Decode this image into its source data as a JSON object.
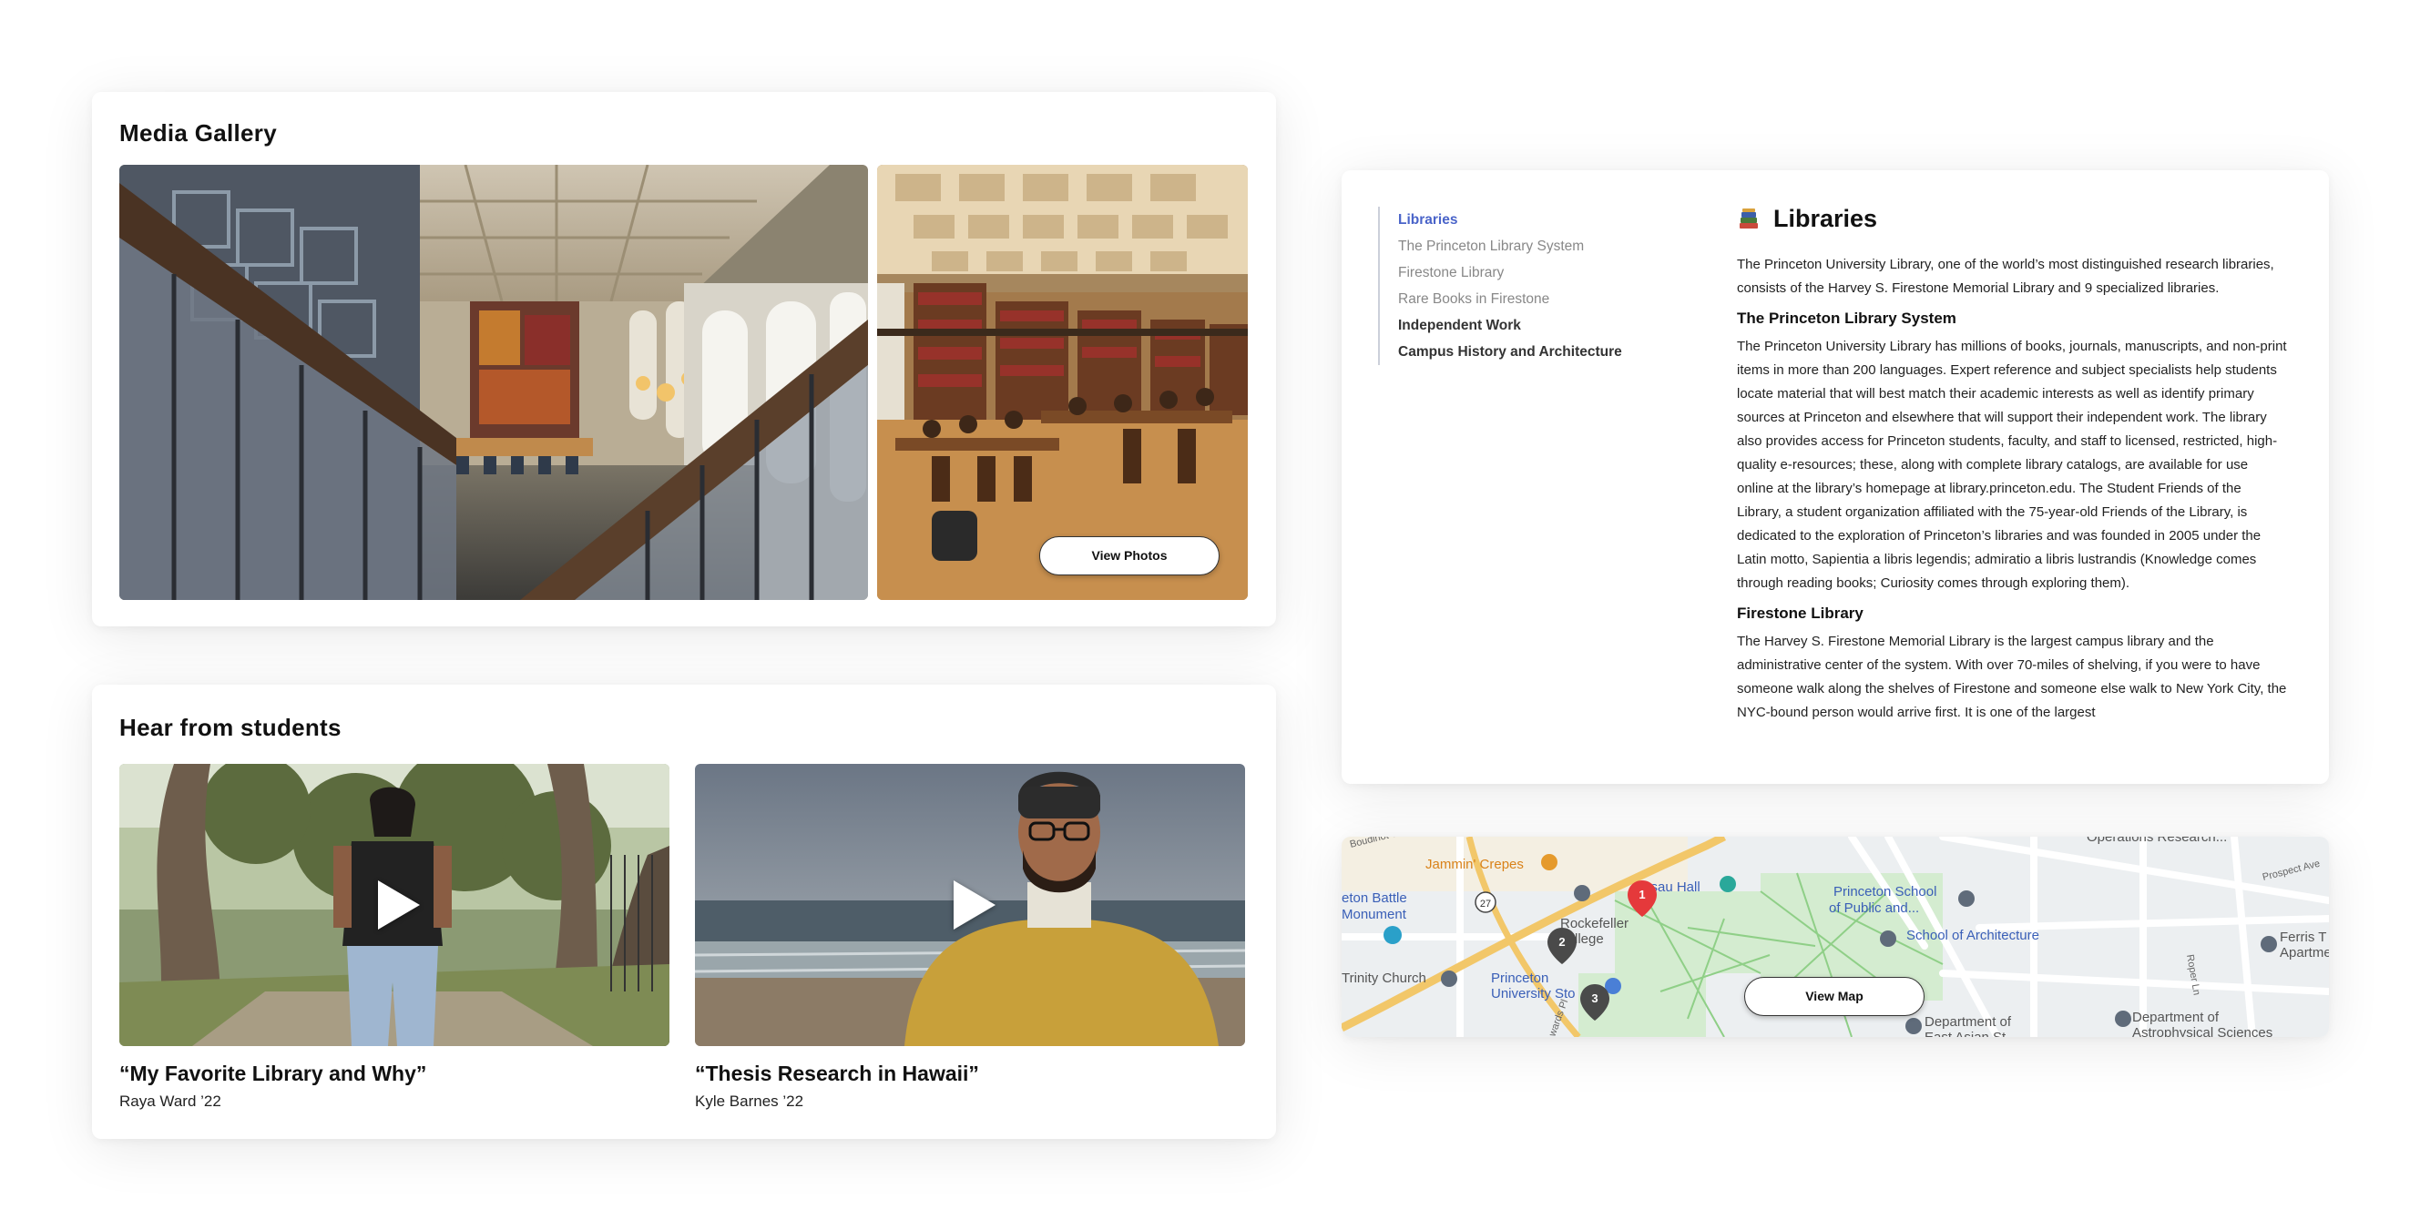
{
  "gallery": {
    "title": "Media Gallery",
    "view_photos_label": "View Photos"
  },
  "students": {
    "title": "Hear from students",
    "videos": [
      {
        "title": "“My Favorite Library and Why”",
        "author": "Raya Ward ’22"
      },
      {
        "title": "“Thesis Research in Hawaii”",
        "author": "Kyle Barnes ’22"
      }
    ]
  },
  "libraries": {
    "toc": [
      "Libraries",
      "The Princeton Library System",
      "Firestone Library",
      "Rare Books in Firestone",
      "Independent Work",
      "Campus History and Architecture"
    ],
    "title": "Libraries",
    "intro": "The Princeton University Library, one of the world’s most distinguished research libraries, consists of the Harvey S. Firestone Memorial Library and 9 specialized libraries.",
    "section1_title": "The Princeton Library System",
    "section1_text": "The Princeton University Library has millions of books, journals, manuscripts, and non-print items in more than 200 languages. Expert reference and subject specialists help students locate material that will best match their academic interests as well as identify primary sources at Princeton and elsewhere that will support their independent work. The library also provides access for Princeton students, faculty, and staff to licensed, restricted, high-quality e-resources; these, along with complete library catalogs, are available for use online at the library’s homepage at library.princeton.edu. The Student Friends of the Library, a student organization affiliated with the 75-year-old Friends of the Library, is dedicated to the exploration of Princeton’s libraries and was founded in 2005 under the Latin motto, Sapientia a libris legendis; admiratio a libris lustrandis (Knowledge comes through reading books; Curiosity comes through exploring them).",
    "section2_title": "Firestone Library",
    "section2_text": "The Harvey S. Firestone Memorial Library is the largest campus library and the administrative center of the system. With over 70-miles of shelving, if you were to have someone walk along the shelves of Firestone and someone else walk to New York City, the NYC-bound person would arrive first. It is one of the largest"
  },
  "map": {
    "labels": {
      "jammin": "Jammin' Crepes",
      "battle1": "eton Battle",
      "battle2": "Monument",
      "nassau": "ssau Hall",
      "school1": "Princeton School",
      "school2": "of Public and...",
      "arch": "School of Architecture",
      "rock1": "Rockefeller",
      "rock2": "llege",
      "trinity": "Trinity Church",
      "store1": "Princeton",
      "store2": "University Sto",
      "ops": "Operations Research...",
      "ferris1": "Ferris T",
      "ferris2": "Apartme",
      "dept1": "Department of",
      "dept2": "Department of",
      "astro": "Astrophysical Sciences",
      "route": "27",
      "boudinot": "Boudinot St",
      "prospect": "Prospect Ave",
      "roper": "Roper Ln",
      "edwards": "wards Pl",
      "dept_partial": "Department of",
      "east_asian": "East Asian St"
    },
    "pins": [
      "1",
      "2",
      "3"
    ],
    "view_map_label": "View Map"
  },
  "colors": {
    "accent": "#4a64c9",
    "pin_red": "#e5393b",
    "pin_dark": "#4a4a4a",
    "map_label_blue": "#3a5fb7",
    "map_label_orange": "#d98219"
  }
}
